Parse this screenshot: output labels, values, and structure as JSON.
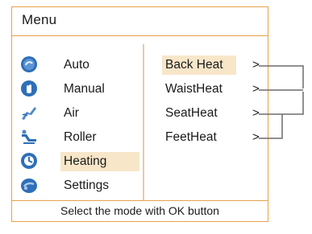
{
  "menu": {
    "title": "Menu",
    "items": [
      {
        "label": "Auto",
        "icon": "auto-mode-icon"
      },
      {
        "label": "Manual",
        "icon": "manual-hand-icon"
      },
      {
        "label": "Air",
        "icon": "air-massage-icon"
      },
      {
        "label": "Roller",
        "icon": "roller-chair-icon"
      },
      {
        "label": "Heating",
        "icon": "heating-icon",
        "selected": true
      },
      {
        "label": "Settings",
        "icon": "settings-icon"
      }
    ]
  },
  "heating": {
    "items": [
      {
        "label": "Back Heat",
        "chevron": ">",
        "selected": true
      },
      {
        "label": "WaistHeat",
        "chevron": ">"
      },
      {
        "label": "SeatHeat",
        "chevron": ">"
      },
      {
        "label": "FeetHeat",
        "chevron": ">"
      }
    ]
  },
  "footer": {
    "hint": "Select the mode with OK button"
  },
  "colors": {
    "frame_border": "#e7a24a",
    "selection_bg": "#f8e6c9",
    "icon_blue": "#2e6fb7",
    "connector_gray": "#6b6b6b"
  }
}
